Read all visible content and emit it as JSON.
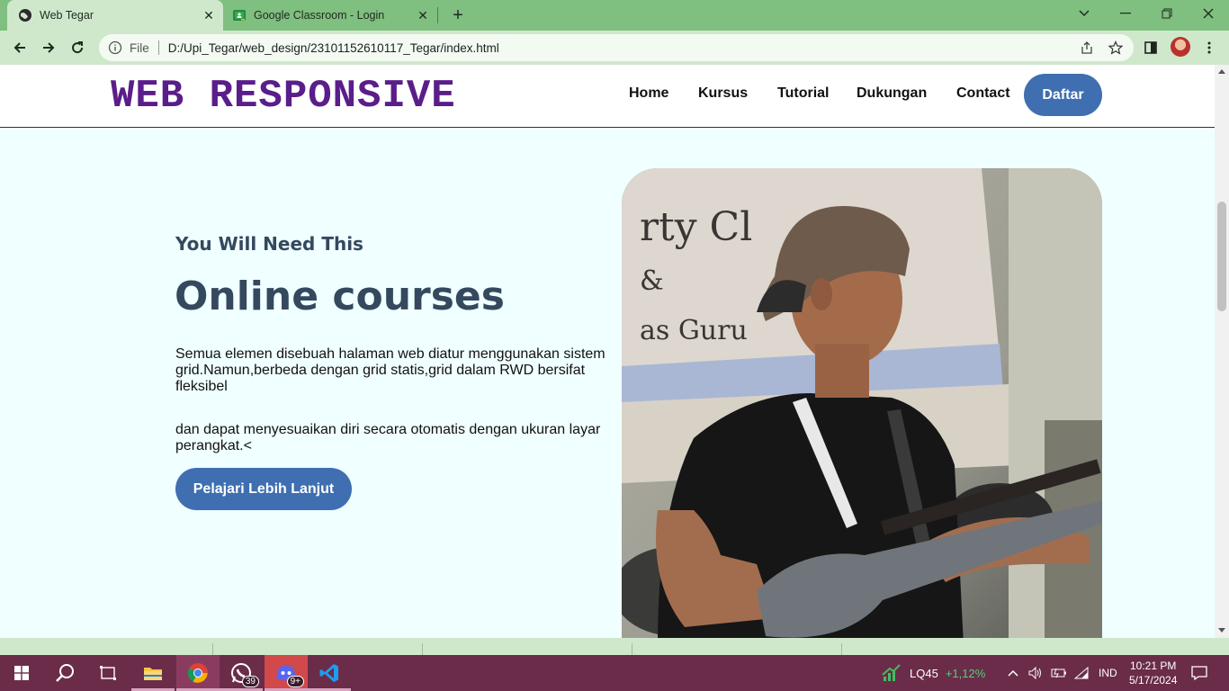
{
  "browser": {
    "tabs": [
      {
        "title": "Web Tegar",
        "active": true,
        "icon": "globe-icon"
      },
      {
        "title": "Google Classroom - Login",
        "active": false,
        "icon": "classroom-icon"
      }
    ],
    "address": {
      "scheme_label": "File",
      "url": "D:/Upi_Tegar/web_design/23101152610117_Tegar/index.html"
    }
  },
  "site": {
    "logo": "WEB RESPONSIVE",
    "nav": [
      "Home",
      "Kursus",
      "Tutorial",
      "Dukungan",
      "Contact"
    ],
    "cta_nav": "Daftar"
  },
  "hero": {
    "subtitle": "You Will Need This",
    "title": "Online courses",
    "paragraph_1": "Semua elemen disebuah halaman web diatur menggunakan sistem grid.Namun,berbeda dengan grid statis,grid dalam RWD bersifat fleksibel",
    "paragraph_2": "dan dapat menyesuaikan diri secara otomatis dengan ukuran layar perangkat.<",
    "button": "Pelajari Lebih Lanjut",
    "image": "guitarist-photo"
  },
  "taskbar": {
    "whatsapp_badge": "39",
    "discord_badge": "9+",
    "stock_name": "LQ45",
    "stock_change": "+1,12%",
    "language": "IND",
    "time": "10:21 PM",
    "date": "5/17/2024"
  },
  "colors": {
    "tab_strip": "#7fbf7f",
    "toolbar": "#cfe8cc",
    "page_bg": "#f0ffff",
    "logo": "#5a1d8a",
    "button": "#3f6fb0",
    "heading": "#34495e",
    "taskbar": "#6b2c49"
  }
}
